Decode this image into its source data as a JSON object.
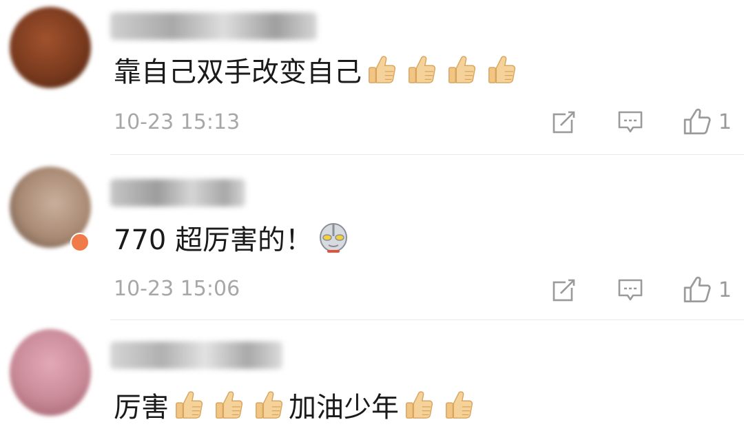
{
  "comments": [
    {
      "text_parts": [
        "靠自己双手改变自己"
      ],
      "emojis_after": [
        "thumbs-up-icon",
        "thumbs-up-icon",
        "thumbs-up-icon",
        "thumbs-up-icon"
      ],
      "timestamp": "10-23 15:13",
      "likes": "1",
      "avatar_color": "#7a3a1e"
    },
    {
      "text_parts": [
        "770 超厉害的！"
      ],
      "emojis_after": [
        "ultraman-icon"
      ],
      "timestamp": "10-23 15:06",
      "likes": "1",
      "avatar_color": "#b89a86"
    },
    {
      "text_parts": [
        "厉害",
        "加油少年"
      ],
      "emojis": [
        "thumbs-up-icon",
        "thumbs-up-icon",
        "thumbs-up-icon",
        "thumbs-up-icon",
        "thumbs-up-icon"
      ],
      "avatar_color": "#c98a98"
    }
  ]
}
